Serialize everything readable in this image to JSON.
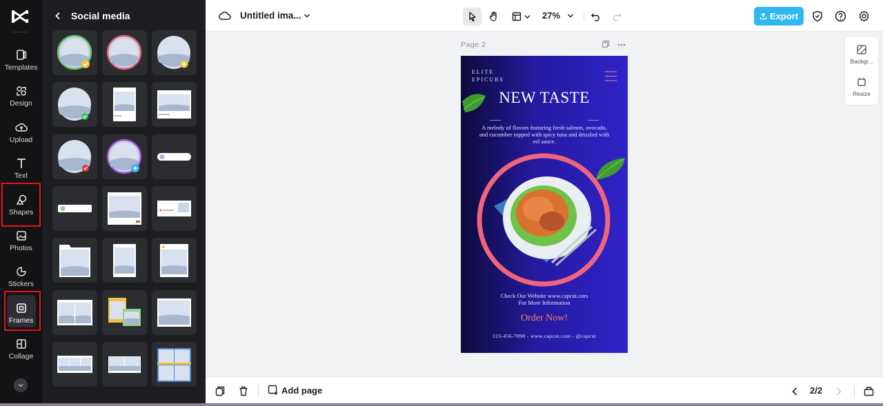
{
  "app": {
    "doc_title": "Untitled ima...",
    "zoom": "27%",
    "export_label": "Export"
  },
  "rail": {
    "items": [
      {
        "label": "Templates",
        "icon": "templates-icon"
      },
      {
        "label": "Design",
        "icon": "design-icon"
      },
      {
        "label": "Upload",
        "icon": "upload-cloud-icon"
      },
      {
        "label": "Text",
        "icon": "text-icon"
      },
      {
        "label": "Shapes",
        "icon": "shapes-icon"
      },
      {
        "label": "Photos",
        "icon": "photos-icon"
      },
      {
        "label": "Stickers",
        "icon": "stickers-icon"
      },
      {
        "label": "Frames",
        "icon": "frames-icon"
      },
      {
        "label": "Collage",
        "icon": "collage-icon"
      }
    ],
    "active": "Frames",
    "highlight_color": "#e8121d"
  },
  "panel": {
    "title": "Social media"
  },
  "canvas": {
    "page_label": "Page 2",
    "side_tools": [
      {
        "label": "Backgr..."
      },
      {
        "label": "Resize"
      }
    ]
  },
  "poster": {
    "brand_line1": "ELITE",
    "brand_line2": "EPICURS",
    "title": "NEW TASTE",
    "description": "A melody of flavors featuring fresh salmon, avocado, and cucumber topped with spicy tuna and drizzled with eel sauce.",
    "website_line1": "Check Our Website www.capcut.cors",
    "website_line2": "For More Information",
    "cta": "Order Now!",
    "contact": "123-456-7890 - www.capcut.com - @capcut"
  },
  "bottom": {
    "add_page_label": "Add page",
    "pager": "2/2"
  },
  "colors": {
    "accent": "#31b7ef",
    "rail_bg": "#121315",
    "panel_bg": "#1d1e21"
  }
}
